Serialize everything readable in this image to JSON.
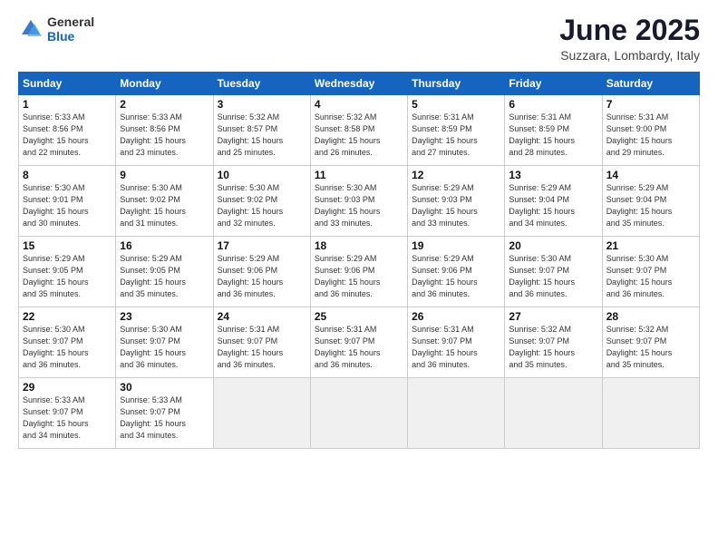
{
  "logo": {
    "general": "General",
    "blue": "Blue"
  },
  "title": "June 2025",
  "subtitle": "Suzzara, Lombardy, Italy",
  "days_of_week": [
    "Sunday",
    "Monday",
    "Tuesday",
    "Wednesday",
    "Thursday",
    "Friday",
    "Saturday"
  ],
  "weeks": [
    [
      {
        "day": "1",
        "info": "Sunrise: 5:33 AM\nSunset: 8:56 PM\nDaylight: 15 hours\nand 22 minutes."
      },
      {
        "day": "2",
        "info": "Sunrise: 5:33 AM\nSunset: 8:56 PM\nDaylight: 15 hours\nand 23 minutes."
      },
      {
        "day": "3",
        "info": "Sunrise: 5:32 AM\nSunset: 8:57 PM\nDaylight: 15 hours\nand 25 minutes."
      },
      {
        "day": "4",
        "info": "Sunrise: 5:32 AM\nSunset: 8:58 PM\nDaylight: 15 hours\nand 26 minutes."
      },
      {
        "day": "5",
        "info": "Sunrise: 5:31 AM\nSunset: 8:59 PM\nDaylight: 15 hours\nand 27 minutes."
      },
      {
        "day": "6",
        "info": "Sunrise: 5:31 AM\nSunset: 8:59 PM\nDaylight: 15 hours\nand 28 minutes."
      },
      {
        "day": "7",
        "info": "Sunrise: 5:31 AM\nSunset: 9:00 PM\nDaylight: 15 hours\nand 29 minutes."
      }
    ],
    [
      {
        "day": "8",
        "info": "Sunrise: 5:30 AM\nSunset: 9:01 PM\nDaylight: 15 hours\nand 30 minutes."
      },
      {
        "day": "9",
        "info": "Sunrise: 5:30 AM\nSunset: 9:02 PM\nDaylight: 15 hours\nand 31 minutes."
      },
      {
        "day": "10",
        "info": "Sunrise: 5:30 AM\nSunset: 9:02 PM\nDaylight: 15 hours\nand 32 minutes."
      },
      {
        "day": "11",
        "info": "Sunrise: 5:30 AM\nSunset: 9:03 PM\nDaylight: 15 hours\nand 33 minutes."
      },
      {
        "day": "12",
        "info": "Sunrise: 5:29 AM\nSunset: 9:03 PM\nDaylight: 15 hours\nand 33 minutes."
      },
      {
        "day": "13",
        "info": "Sunrise: 5:29 AM\nSunset: 9:04 PM\nDaylight: 15 hours\nand 34 minutes."
      },
      {
        "day": "14",
        "info": "Sunrise: 5:29 AM\nSunset: 9:04 PM\nDaylight: 15 hours\nand 35 minutes."
      }
    ],
    [
      {
        "day": "15",
        "info": "Sunrise: 5:29 AM\nSunset: 9:05 PM\nDaylight: 15 hours\nand 35 minutes."
      },
      {
        "day": "16",
        "info": "Sunrise: 5:29 AM\nSunset: 9:05 PM\nDaylight: 15 hours\nand 35 minutes."
      },
      {
        "day": "17",
        "info": "Sunrise: 5:29 AM\nSunset: 9:06 PM\nDaylight: 15 hours\nand 36 minutes."
      },
      {
        "day": "18",
        "info": "Sunrise: 5:29 AM\nSunset: 9:06 PM\nDaylight: 15 hours\nand 36 minutes."
      },
      {
        "day": "19",
        "info": "Sunrise: 5:29 AM\nSunset: 9:06 PM\nDaylight: 15 hours\nand 36 minutes."
      },
      {
        "day": "20",
        "info": "Sunrise: 5:30 AM\nSunset: 9:07 PM\nDaylight: 15 hours\nand 36 minutes."
      },
      {
        "day": "21",
        "info": "Sunrise: 5:30 AM\nSunset: 9:07 PM\nDaylight: 15 hours\nand 36 minutes."
      }
    ],
    [
      {
        "day": "22",
        "info": "Sunrise: 5:30 AM\nSunset: 9:07 PM\nDaylight: 15 hours\nand 36 minutes."
      },
      {
        "day": "23",
        "info": "Sunrise: 5:30 AM\nSunset: 9:07 PM\nDaylight: 15 hours\nand 36 minutes."
      },
      {
        "day": "24",
        "info": "Sunrise: 5:31 AM\nSunset: 9:07 PM\nDaylight: 15 hours\nand 36 minutes."
      },
      {
        "day": "25",
        "info": "Sunrise: 5:31 AM\nSunset: 9:07 PM\nDaylight: 15 hours\nand 36 minutes."
      },
      {
        "day": "26",
        "info": "Sunrise: 5:31 AM\nSunset: 9:07 PM\nDaylight: 15 hours\nand 36 minutes."
      },
      {
        "day": "27",
        "info": "Sunrise: 5:32 AM\nSunset: 9:07 PM\nDaylight: 15 hours\nand 35 minutes."
      },
      {
        "day": "28",
        "info": "Sunrise: 5:32 AM\nSunset: 9:07 PM\nDaylight: 15 hours\nand 35 minutes."
      }
    ],
    [
      {
        "day": "29",
        "info": "Sunrise: 5:33 AM\nSunset: 9:07 PM\nDaylight: 15 hours\nand 34 minutes."
      },
      {
        "day": "30",
        "info": "Sunrise: 5:33 AM\nSunset: 9:07 PM\nDaylight: 15 hours\nand 34 minutes."
      },
      {
        "day": "",
        "info": "",
        "empty": true
      },
      {
        "day": "",
        "info": "",
        "empty": true
      },
      {
        "day": "",
        "info": "",
        "empty": true
      },
      {
        "day": "",
        "info": "",
        "empty": true
      },
      {
        "day": "",
        "info": "",
        "empty": true
      }
    ]
  ]
}
